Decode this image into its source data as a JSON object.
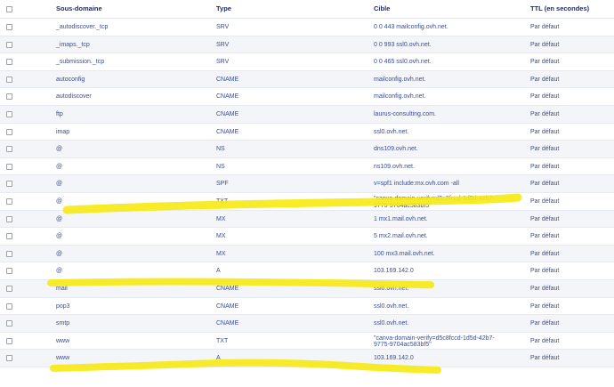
{
  "columns": {
    "subdomain": "Sous-domaine",
    "type": "Type",
    "target": "Cible",
    "ttl": "TTL (en secondes)"
  },
  "rows": [
    {
      "subdomain": "_autodiscover._tcp",
      "type": "SRV",
      "target": "0 0 443 mailconfig.ovh.net.",
      "ttl": "Par défaut"
    },
    {
      "subdomain": "_imaps._tcp",
      "type": "SRV",
      "target": "0 0 993 ssl0.ovh.net.",
      "ttl": "Par défaut"
    },
    {
      "subdomain": "_submission._tcp",
      "type": "SRV",
      "target": "0 0 465 ssl0.ovh.net.",
      "ttl": "Par défaut"
    },
    {
      "subdomain": "autoconfig",
      "type": "CNAME",
      "target": "mailconfig.ovh.net.",
      "ttl": "Par défaut"
    },
    {
      "subdomain": "autodiscover",
      "type": "CNAME",
      "target": "mailconfig.ovh.net.",
      "ttl": "Par défaut"
    },
    {
      "subdomain": "ftp",
      "type": "CNAME",
      "target": "laurus-consulting.com.",
      "ttl": "Par défaut"
    },
    {
      "subdomain": "imap",
      "type": "CNAME",
      "target": "ssl0.ovh.net.",
      "ttl": "Par défaut"
    },
    {
      "subdomain": "@",
      "type": "NS",
      "target": "dns109.ovh.net.",
      "ttl": "Par défaut"
    },
    {
      "subdomain": "@",
      "type": "NS",
      "target": "ns109.ovh.net.",
      "ttl": "Par défaut"
    },
    {
      "subdomain": "@",
      "type": "SPF",
      "target": "v=spf1 include:mx.ovh.com -all",
      "ttl": "Par défaut"
    },
    {
      "subdomain": "@",
      "type": "TXT",
      "target": "\"canva-domain-verify=d5c8fccd-1d5d-42b7-9775-9704ac583bf5\"",
      "ttl": "Par défaut"
    },
    {
      "subdomain": "@",
      "type": "MX",
      "target": "1 mx1.mail.ovh.net.",
      "ttl": "Par défaut"
    },
    {
      "subdomain": "@",
      "type": "MX",
      "target": "5 mx2.mail.ovh.net.",
      "ttl": "Par défaut"
    },
    {
      "subdomain": "@",
      "type": "MX",
      "target": "100 mx3.mail.ovh.net.",
      "ttl": "Par défaut"
    },
    {
      "subdomain": "@",
      "type": "A",
      "target": "103.169.142.0",
      "ttl": "Par défaut"
    },
    {
      "subdomain": "mail",
      "type": "CNAME",
      "target": "ssl0.ovh.net.",
      "ttl": "Par défaut"
    },
    {
      "subdomain": "pop3",
      "type": "CNAME",
      "target": "ssl0.ovh.net.",
      "ttl": "Par défaut"
    },
    {
      "subdomain": "smtp",
      "type": "CNAME",
      "target": "ssl0.ovh.net.",
      "ttl": "Par défaut"
    },
    {
      "subdomain": "www",
      "type": "TXT",
      "target": "\"canva-domain-verify=d5c8fccd-1d5d-42b7-9775-9704ac583bf5\"",
      "ttl": "Par défaut"
    },
    {
      "subdomain": "www",
      "type": "A",
      "target": "103.169.142.0",
      "ttl": "Par défaut"
    }
  ],
  "highlight_color": "#f7ea12"
}
